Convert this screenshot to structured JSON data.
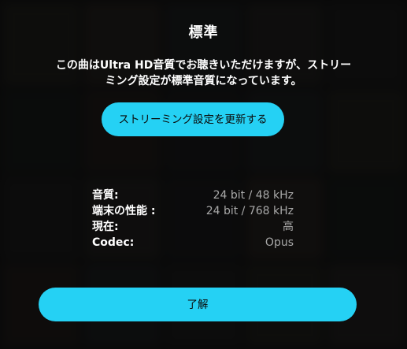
{
  "dialog": {
    "title": "標準",
    "message_line1": "この曲はUltra HD音質でお聴きいただけますが、ストリー",
    "message_line2": "ミング設定が標準音質になっています。",
    "update_button_label": "ストリーミング設定を更新する",
    "ok_button_label": "了解"
  },
  "quality_info": [
    {
      "label": "音質:",
      "value": "24 bit / 48 kHz"
    },
    {
      "label": "端末の性能 :",
      "value": "24 bit / 768 kHz"
    },
    {
      "label": "現在:",
      "value": "高"
    },
    {
      "label": "Codec:",
      "value": "Opus"
    }
  ],
  "colors": {
    "accent": "#25d1f4",
    "overlay": "#060606",
    "value_text": "#a9a9a9"
  }
}
